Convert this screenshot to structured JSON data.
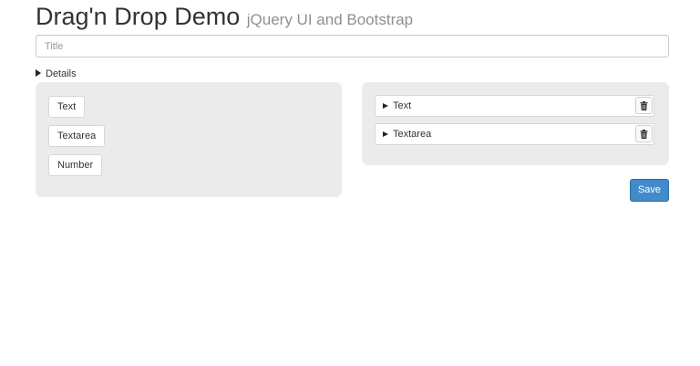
{
  "header": {
    "title": "Drag'n Drop Demo",
    "subtitle": "jQuery UI and Bootstrap"
  },
  "form": {
    "title_placeholder": "Title",
    "title_value": "",
    "details_label": "Details"
  },
  "palette": {
    "items": [
      {
        "label": "Text"
      },
      {
        "label": "Textarea"
      },
      {
        "label": "Number"
      }
    ]
  },
  "canvas": {
    "fields": [
      {
        "label": "Text",
        "icon": "trash-icon"
      },
      {
        "label": "Textarea",
        "icon": "trash-icon"
      }
    ]
  },
  "actions": {
    "save_label": "Save"
  },
  "colors": {
    "primary": "#428bca",
    "panel_bg": "#ebebeb",
    "subtitle": "#8f8f8f"
  }
}
